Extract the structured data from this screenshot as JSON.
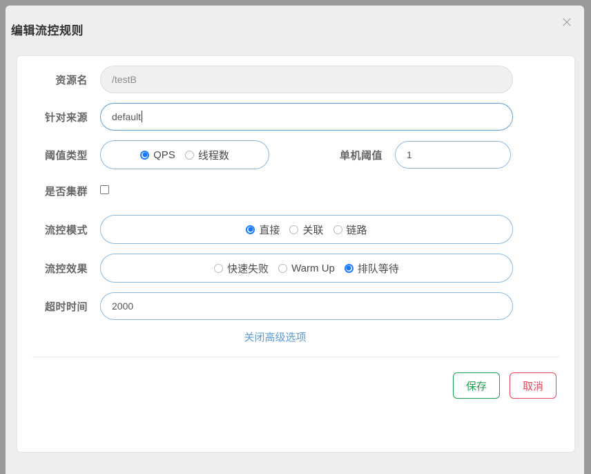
{
  "dialog": {
    "title": "编辑流控规则",
    "close_icon": "close-icon",
    "close_label": "×"
  },
  "form": {
    "resource": {
      "label": "资源名",
      "value": "/testB",
      "disabled": true
    },
    "origin": {
      "label": "针对来源",
      "value": "default",
      "focused": true
    },
    "threshold_type": {
      "label": "阈值类型",
      "options": [
        "QPS",
        "线程数"
      ],
      "selected": "QPS"
    },
    "single_threshold": {
      "label": "单机阈值",
      "value": "1"
    },
    "is_cluster": {
      "label": "是否集群",
      "checked": false
    },
    "flow_mode": {
      "label": "流控模式",
      "options": [
        "直接",
        "关联",
        "链路"
      ],
      "selected": "直接"
    },
    "flow_effect": {
      "label": "流控效果",
      "options": [
        "快速失败",
        "Warm Up",
        "排队等待"
      ],
      "selected": "排队等待"
    },
    "timeout": {
      "label": "超时时间",
      "value": "2000"
    },
    "advanced_link": "关闭高级选项"
  },
  "footer": {
    "save_label": "保存",
    "cancel_label": "取消"
  },
  "colors": {
    "accent_blue": "#1677ff",
    "border_blue": "#8cb7dd",
    "link_blue": "#5b9bd5",
    "save_green": "#1aa052",
    "cancel_red": "#e8445a",
    "label_gray": "#666666",
    "backdrop_gray": "#9a9a9a",
    "dialog_bg": "#eeeeee"
  }
}
